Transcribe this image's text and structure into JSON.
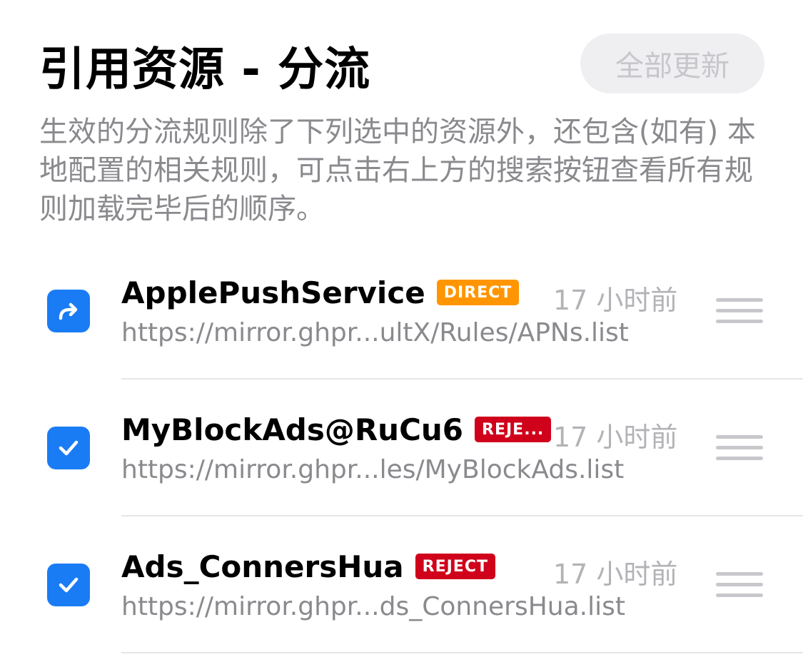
{
  "header": {
    "title": "引用资源 - 分流",
    "update_all_label": "全部更新",
    "description": "生效的分流规则除了下列选中的资源外，还包含(如有) 本地配置的相关规则，可点击右上方的搜索按钮查看所有规则加载完毕后的顺序。"
  },
  "colors": {
    "accent": "#1a7cf5",
    "direct": "#ff9500",
    "reject": "#d0021b"
  },
  "rules": [
    {
      "name": "ApplePushService",
      "policy": "DIRECT",
      "policy_color": "#ff9500",
      "updated": "17 小时前",
      "url": "https://mirror.ghpr...ultX/Rules/APNs.list",
      "checkbox_icon": "arrow-icon"
    },
    {
      "name": "MyBlockAds@RuCu6",
      "policy": "REJE...",
      "policy_color": "#d0021b",
      "updated": "17 小时前",
      "url": "https://mirror.ghpr...les/MyBlockAds.list",
      "checkbox_icon": "checkmark-icon"
    },
    {
      "name": "Ads_ConnersHua",
      "policy": "REJECT",
      "policy_color": "#d0021b",
      "updated": "17 小时前",
      "url": "https://mirror.ghpr...ds_ConnersHua.list",
      "checkbox_icon": "checkmark-icon"
    }
  ]
}
